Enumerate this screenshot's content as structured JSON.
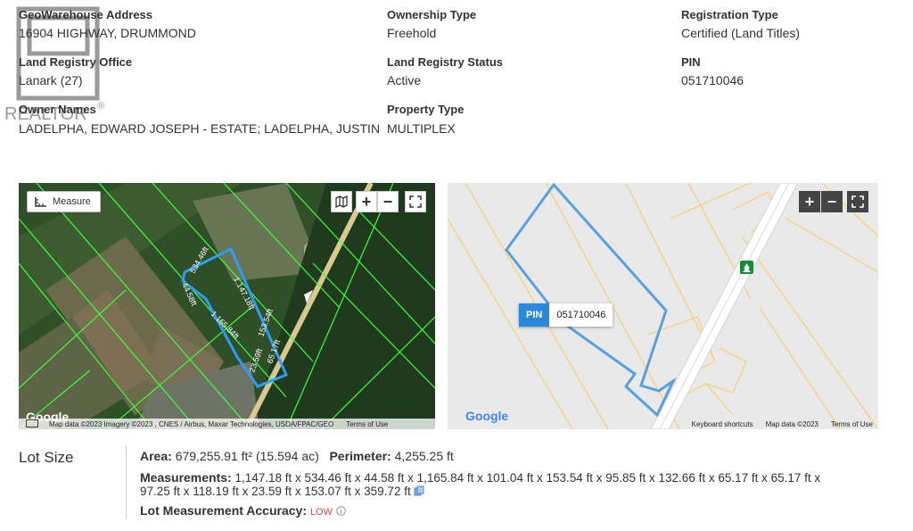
{
  "property": {
    "address_label": "GeoWarehouse Address",
    "address_value": "16904 HIGHWAY, DRUMMOND",
    "ownership_label": "Ownership Type",
    "ownership_value": "Freehold",
    "registration_label": "Registration Type",
    "registration_value": "Certified (Land Titles)",
    "office_label": "Land Registry Office",
    "office_value": "Lanark (27)",
    "status_label": "Land Registry Status",
    "status_value": "Active",
    "pin_label": "PIN",
    "pin_value": "051710046",
    "owner_label": "Owner Names",
    "owner_value": "LADELPHA, EDWARD JOSEPH - ESTATE; LADELPHA, JUSTIN",
    "type_label": "Property Type",
    "type_value": "MULTIPLEX"
  },
  "logo": {
    "text": "REALTOR",
    "mark": "®"
  },
  "satellite_map": {
    "measure_label": "Measure",
    "buttons": [
      "map-icon",
      "zoom-in-icon",
      "zoom-out-icon",
      "fullscreen-icon"
    ],
    "measure_labels": [
      "534.46ft",
      "44.58ft",
      "1,147.18ft",
      "1,165.84ft",
      "153.54ft",
      "65.17ft",
      "23.59ft"
    ],
    "google": "Google",
    "attribution": "Map data ©2023 Imagery ©2023 , CNES / Airbus, Maxar Technologies, USDA/FPAC/GEO",
    "terms": "Terms of Use"
  },
  "road_map": {
    "pin_key": "PIN",
    "pin_value": "051710046",
    "google": "Google",
    "shortcuts": "Keyboard shortcuts",
    "map_data": "Map data ©2023",
    "terms": "Terms of Use"
  },
  "lot": {
    "title": "Lot Size",
    "area_label": "Area:",
    "area_value": "679,255.91 ft² (15.594 ac)",
    "perimeter_label": "Perimeter:",
    "perimeter_value": "4,255.25 ft",
    "measurements_label": "Measurements:",
    "measurements_line1": "1,147.18 ft x 534.46 ft x 44.58 ft x 1,165.84 ft x 101.04 ft x 153.54 ft x 95.85 ft x 132.66 ft x 65.17 ft x 65.17 ft x",
    "measurements_line2": "97.25 ft x 118.19 ft x 23.59 ft x 153.07 ft x 359.72 ft",
    "accuracy_label": "Lot Measurement Accuracy:",
    "accuracy_value": "LOW"
  },
  "colors": {
    "parcel": "#5aa0e0",
    "sat_lines": "#3cff3c",
    "accuracy": "#e24444"
  }
}
